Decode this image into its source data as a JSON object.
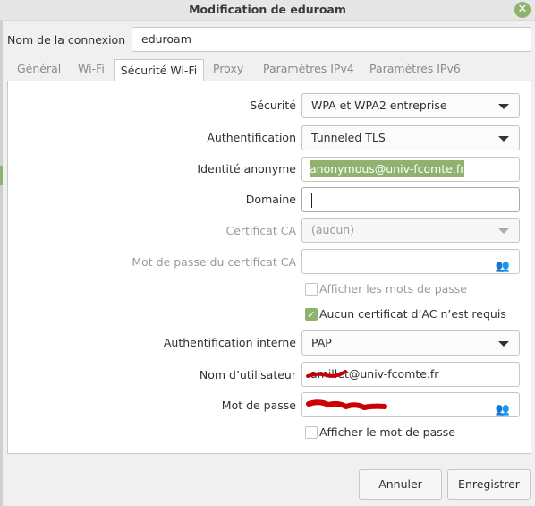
{
  "window": {
    "title": "Modification de eduroam",
    "close_icon": "close-icon"
  },
  "connection": {
    "label": "Nom de la connexion",
    "value": "eduroam"
  },
  "tabs": [
    {
      "label": "Général"
    },
    {
      "label": "Wi-Fi"
    },
    {
      "label": "Sécurité Wi-Fi",
      "active": true
    },
    {
      "label": "Proxy"
    },
    {
      "label": "Paramètres IPv4"
    },
    {
      "label": "Paramètres IPv6"
    }
  ],
  "form": {
    "security": {
      "label": "Sécurité",
      "value": "WPA et WPA2 entreprise"
    },
    "auth": {
      "label": "Authentification",
      "value": "Tunneled TLS"
    },
    "anon_identity": {
      "label": "Identité anonyme",
      "value": "anonymous@univ-fcomte.fr"
    },
    "domain": {
      "label": "Domaine",
      "value": ""
    },
    "ca_cert": {
      "label": "Certificat CA",
      "value": "(aucun)"
    },
    "ca_password": {
      "label": "Mot de passe du certificat CA",
      "value": ""
    },
    "show_passwords": {
      "label": "Afficher les mots de passe",
      "checked": false
    },
    "no_ca_required": {
      "label": "Aucun certificat d’AC n’est requis",
      "checked": true
    },
    "inner_auth": {
      "label": "Authentification interne",
      "value": "PAP"
    },
    "username": {
      "label": "Nom d’utilisateur",
      "value": "amillet@univ-fcomte.fr"
    },
    "password": {
      "label": "Mot de passe"
    },
    "show_password": {
      "label": "Afficher le mot de passe",
      "checked": false
    }
  },
  "buttons": {
    "cancel": "Annuler",
    "save": "Enregistrer"
  },
  "colors": {
    "accent": "#8fb36e",
    "redaction": "#cc0000"
  }
}
